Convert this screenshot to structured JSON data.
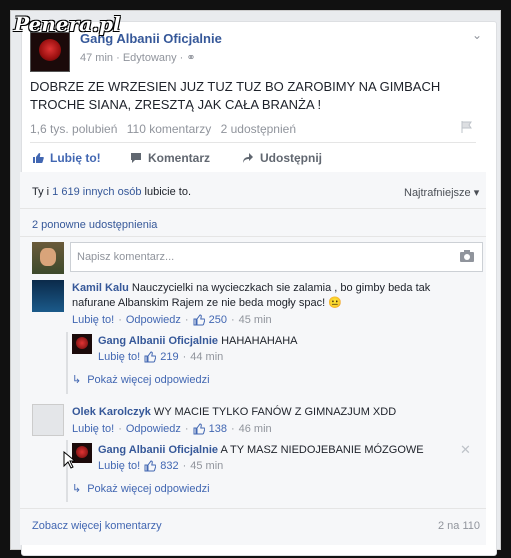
{
  "watermark": "Penera.pl",
  "post": {
    "page_name": "Gang Albanii Oficjalnie",
    "time": "47 min",
    "edited": "Edytowany",
    "text": "DOBRZE ZE WRZESIEN JUZ TUZ TUZ BO ZAROBIMY NA GIMBACH TROCHE SIANA, ZRESZTĄ JAK CAŁA BRANŻA !",
    "likes": "1,6 tys. polubień",
    "comments": "110 komentarzy",
    "shares": "2 udostępnień"
  },
  "actions": {
    "like": "Lubię to!",
    "comment": "Komentarz",
    "share": "Udostępnij"
  },
  "likers": {
    "prefix": "Ty i ",
    "link": "1 619 innych osób",
    "suffix": " lubicie to."
  },
  "sort_label": "Najtrafniejsze ▾",
  "reshares": "2 ponowne udostępnienia",
  "comment_input": {
    "placeholder": "Napisz komentarz..."
  },
  "comments": [
    {
      "name": "Kamil Kalu",
      "text": " Nauczycielki na wycieczkach sie zalamia , bo gimby beda tak nafurane Albanskim Rajem ze nie beda mogły spac! 😐",
      "like": "Lubię to!",
      "reply": "Odpowiedz",
      "count": "250",
      "time": "45 min",
      "reply_item": {
        "name": "Gang Albanii Oficjalnie",
        "text": " HAHAHAHAHA",
        "like": "Lubię to!",
        "count": "219",
        "time": "44 min"
      },
      "more": "Pokaż więcej odpowiedzi"
    },
    {
      "name": "Olek Karolczyk",
      "text": " WY MACIE TYLKO FANÓW Z GIMNAZJUM XDD",
      "like": "Lubię to!",
      "reply": "Odpowiedz",
      "count": "138",
      "time": "46 min",
      "reply_item": {
        "name": "Gang Albanii Oficjalnie",
        "text": " A TY MASZ NIEDOJEBANIE MÓZGOWE",
        "like": "Lubię to!",
        "count": "832",
        "time": "45 min"
      },
      "more": "Pokaż więcej odpowiedzi"
    }
  ],
  "footer": {
    "more_comments": "Zobacz więcej komentarzy",
    "count": "2 na 110"
  },
  "colors": {
    "link": "#365899",
    "action_blue": "#4267b2",
    "muted": "#90949c"
  }
}
